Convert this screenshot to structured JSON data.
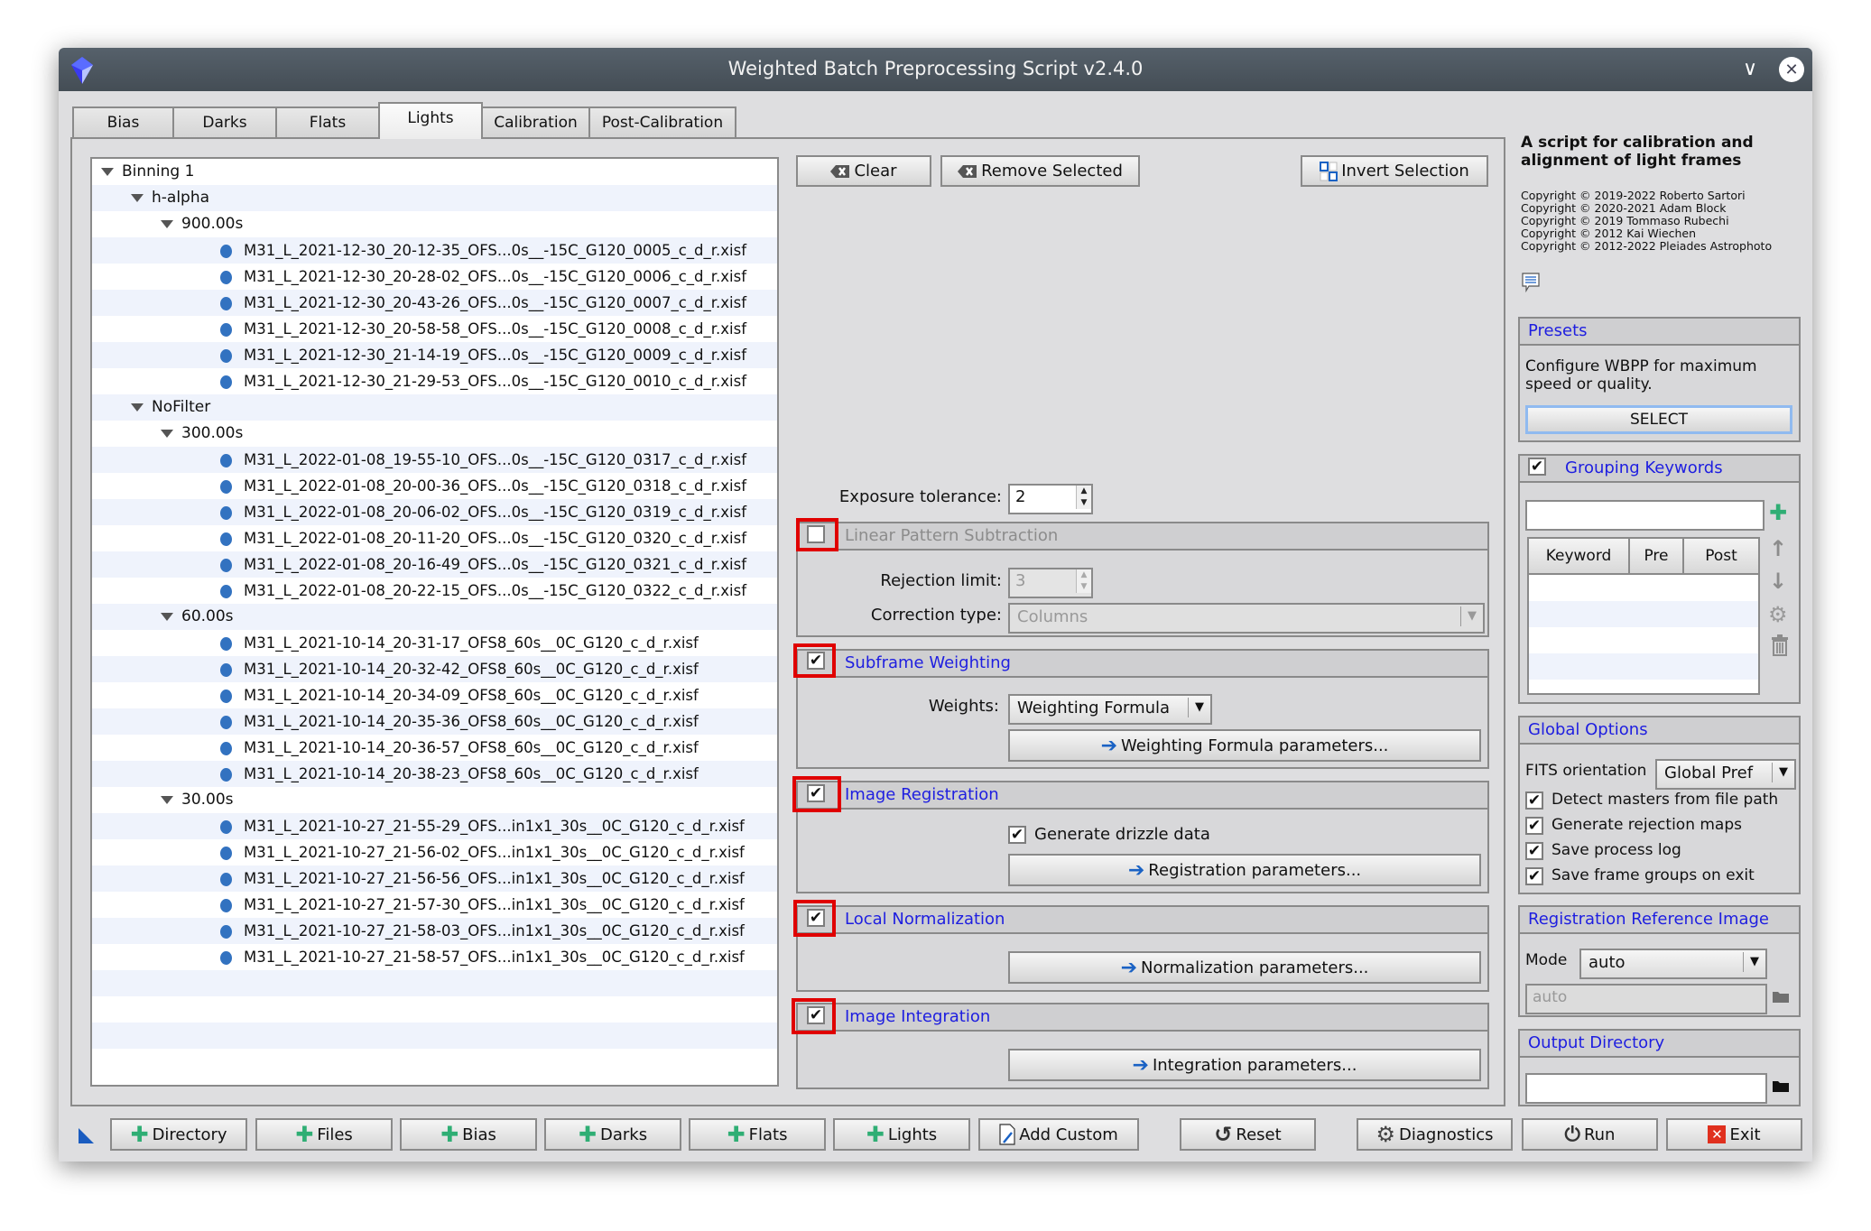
{
  "window": {
    "title": "Weighted Batch Preprocessing Script v2.4.0",
    "controls": {
      "minimize": "∨",
      "maximize": "∧",
      "close": "✕"
    }
  },
  "tabs": [
    {
      "label": "Bias",
      "selected": false
    },
    {
      "label": "Darks",
      "selected": false
    },
    {
      "label": "Flats",
      "selected": false
    },
    {
      "label": "Lights",
      "selected": true
    },
    {
      "label": "Calibration",
      "selected": false
    },
    {
      "label": "Post-Calibration",
      "selected": false
    }
  ],
  "tree": {
    "rows": [
      {
        "level": 0,
        "type": "group",
        "label": "Binning 1"
      },
      {
        "level": 1,
        "type": "group",
        "label": "h-alpha"
      },
      {
        "level": 2,
        "type": "group",
        "label": "900.00s"
      },
      {
        "level": 3,
        "type": "file",
        "label": "M31_L_2021-12-30_20-12-35_OFS...0s__-15C_G120_0005_c_d_r.xisf"
      },
      {
        "level": 3,
        "type": "file",
        "label": "M31_L_2021-12-30_20-28-02_OFS...0s__-15C_G120_0006_c_d_r.xisf"
      },
      {
        "level": 3,
        "type": "file",
        "label": "M31_L_2021-12-30_20-43-26_OFS...0s__-15C_G120_0007_c_d_r.xisf"
      },
      {
        "level": 3,
        "type": "file",
        "label": "M31_L_2021-12-30_20-58-58_OFS...0s__-15C_G120_0008_c_d_r.xisf"
      },
      {
        "level": 3,
        "type": "file",
        "label": "M31_L_2021-12-30_21-14-19_OFS...0s__-15C_G120_0009_c_d_r.xisf"
      },
      {
        "level": 3,
        "type": "file",
        "label": "M31_L_2021-12-30_21-29-53_OFS...0s__-15C_G120_0010_c_d_r.xisf"
      },
      {
        "level": 1,
        "type": "group",
        "label": "NoFilter"
      },
      {
        "level": 2,
        "type": "group",
        "label": "300.00s"
      },
      {
        "level": 3,
        "type": "file",
        "label": "M31_L_2022-01-08_19-55-10_OFS...0s__-15C_G120_0317_c_d_r.xisf"
      },
      {
        "level": 3,
        "type": "file",
        "label": "M31_L_2022-01-08_20-00-36_OFS...0s__-15C_G120_0318_c_d_r.xisf"
      },
      {
        "level": 3,
        "type": "file",
        "label": "M31_L_2022-01-08_20-06-02_OFS...0s__-15C_G120_0319_c_d_r.xisf"
      },
      {
        "level": 3,
        "type": "file",
        "label": "M31_L_2022-01-08_20-11-20_OFS...0s__-15C_G120_0320_c_d_r.xisf"
      },
      {
        "level": 3,
        "type": "file",
        "label": "M31_L_2022-01-08_20-16-49_OFS...0s__-15C_G120_0321_c_d_r.xisf"
      },
      {
        "level": 3,
        "type": "file",
        "label": "M31_L_2022-01-08_20-22-15_OFS...0s__-15C_G120_0322_c_d_r.xisf"
      },
      {
        "level": 2,
        "type": "group",
        "label": "60.00s"
      },
      {
        "level": 3,
        "type": "file",
        "label": "M31_L_2021-10-14_20-31-17_OFS8_60s__0C_G120_c_d_r.xisf"
      },
      {
        "level": 3,
        "type": "file",
        "label": "M31_L_2021-10-14_20-32-42_OFS8_60s__0C_G120_c_d_r.xisf"
      },
      {
        "level": 3,
        "type": "file",
        "label": "M31_L_2021-10-14_20-34-09_OFS8_60s__0C_G120_c_d_r.xisf"
      },
      {
        "level": 3,
        "type": "file",
        "label": "M31_L_2021-10-14_20-35-36_OFS8_60s__0C_G120_c_d_r.xisf"
      },
      {
        "level": 3,
        "type": "file",
        "label": "M31_L_2021-10-14_20-36-57_OFS8_60s__0C_G120_c_d_r.xisf"
      },
      {
        "level": 3,
        "type": "file",
        "label": "M31_L_2021-10-14_20-38-23_OFS8_60s__0C_G120_c_d_r.xisf"
      },
      {
        "level": 2,
        "type": "group",
        "label": "30.00s"
      },
      {
        "level": 3,
        "type": "file",
        "label": "M31_L_2021-10-27_21-55-29_OFS...in1x1_30s__0C_G120_c_d_r.xisf"
      },
      {
        "level": 3,
        "type": "file",
        "label": "M31_L_2021-10-27_21-56-02_OFS...in1x1_30s__0C_G120_c_d_r.xisf"
      },
      {
        "level": 3,
        "type": "file",
        "label": "M31_L_2021-10-27_21-56-56_OFS...in1x1_30s__0C_G120_c_d_r.xisf"
      },
      {
        "level": 3,
        "type": "file",
        "label": "M31_L_2021-10-27_21-57-30_OFS...in1x1_30s__0C_G120_c_d_r.xisf"
      },
      {
        "level": 3,
        "type": "file",
        "label": "M31_L_2021-10-27_21-58-03_OFS...in1x1_30s__0C_G120_c_d_r.xisf"
      },
      {
        "level": 3,
        "type": "file",
        "label": "M31_L_2021-10-27_21-58-57_OFS...in1x1_30s__0C_G120_c_d_r.xisf"
      }
    ]
  },
  "list_actions": {
    "clear": "Clear",
    "remove_selected": "Remove Selected",
    "invert_selection": "Invert Selection"
  },
  "exposure_tolerance": {
    "label": "Exposure tolerance:",
    "value": "2"
  },
  "sections": {
    "lps": {
      "title": "Linear Pattern Subtraction",
      "checked": false,
      "rejection_label": "Rejection limit:",
      "rejection_value": "3",
      "correction_label": "Correction type:",
      "correction_value": "Columns"
    },
    "subframe": {
      "title": "Subframe Weighting",
      "checked": true,
      "weights_label": "Weights:",
      "weights_value": "Weighting Formula",
      "params_button": "Weighting Formula parameters..."
    },
    "registration": {
      "title": "Image Registration",
      "checked": true,
      "drizzle_label": "Generate drizzle data",
      "drizzle_checked": true,
      "params_button": "Registration parameters..."
    },
    "normalization": {
      "title": "Local Normalization",
      "checked": true,
      "params_button": "Normalization parameters..."
    },
    "integration": {
      "title": "Image Integration",
      "checked": true,
      "params_button": "Integration parameters..."
    }
  },
  "info": {
    "heading": "A script for calibration and alignment of light frames",
    "copyrights": [
      "Copyright © 2019-2022 Roberto Sartori",
      "Copyright © 2020-2021 Adam Block",
      "Copyright © 2019 Tommaso Rubechi",
      "Copyright © 2012 Kai Wiechen",
      "Copyright © 2012-2022 Pleiades Astrophoto"
    ]
  },
  "presets": {
    "title": "Presets",
    "description": "Configure WBPP for maximum speed or quality.",
    "select_button": "SELECT"
  },
  "grouping_keywords": {
    "title": "Grouping Keywords",
    "checked": true,
    "input_value": "",
    "columns": [
      "Keyword",
      "Pre",
      "Post"
    ],
    "rows": []
  },
  "global_options": {
    "title": "Global Options",
    "fits_label": "FITS orientation",
    "fits_value": "Global Pref",
    "checkboxes": [
      {
        "label": "Detect masters from file path",
        "checked": true
      },
      {
        "label": "Generate rejection maps",
        "checked": true
      },
      {
        "label": "Save process log",
        "checked": true
      },
      {
        "label": "Save frame groups on exit",
        "checked": true
      }
    ]
  },
  "registration_reference": {
    "title": "Registration Reference Image",
    "mode_label": "Mode",
    "mode_value": "auto",
    "path_value": "auto"
  },
  "output_directory": {
    "title": "Output Directory",
    "value": ""
  },
  "bottom_bar": {
    "add_buttons": [
      "Directory",
      "Files",
      "Bias",
      "Darks",
      "Flats",
      "Lights"
    ],
    "add_custom": "Add Custom",
    "reset": "Reset",
    "diagnostics": "Diagnostics",
    "run": "Run",
    "exit": "Exit"
  },
  "colors": {
    "section_title": "#1e1ee0",
    "highlight_box": "#e00000",
    "file_dot": "#3272c0",
    "add_icon": "#2fae74",
    "arrow_icon": "#1a62c4",
    "exit_icon": "#e0301e"
  }
}
